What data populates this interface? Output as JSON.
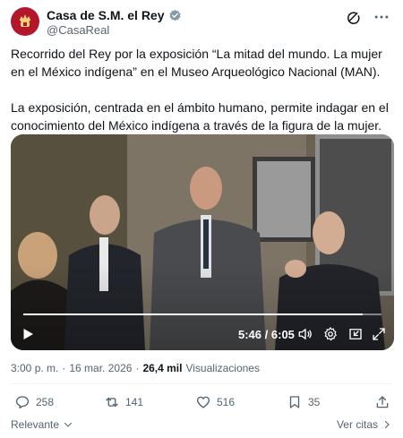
{
  "account": {
    "name": "Casa de S.M. el Rey",
    "handle": "@CasaReal",
    "avatar_icon": "royal-crown-icon",
    "verified_icon": "verified-badge-icon",
    "brand_color": "#b3172c"
  },
  "tweet": {
    "paragraph1": "Recorrido del Rey por la exposición “La mitad del mundo. La mujer en el México indígena” en el Museo Arqueológico Nacional (MAN).",
    "paragraph2": "La exposición, centrada en el ámbito humano, permite indagar en el conocimiento del México indígena a través de la figura de la mujer."
  },
  "video": {
    "current_time": "5:46",
    "duration": "6:05",
    "progress_fraction": 0.948
  },
  "meta": {
    "time": "3:00 p. m.",
    "separator": "·",
    "date": "16 mar. 2026",
    "views_count": "26,4 mil",
    "views_label": "Visualizaciones"
  },
  "actions": {
    "replies": "258",
    "reposts": "141",
    "likes": "516",
    "bookmarks": "35"
  },
  "footer": {
    "sort_label": "Relevante",
    "quotes_label": "Ver citas"
  }
}
